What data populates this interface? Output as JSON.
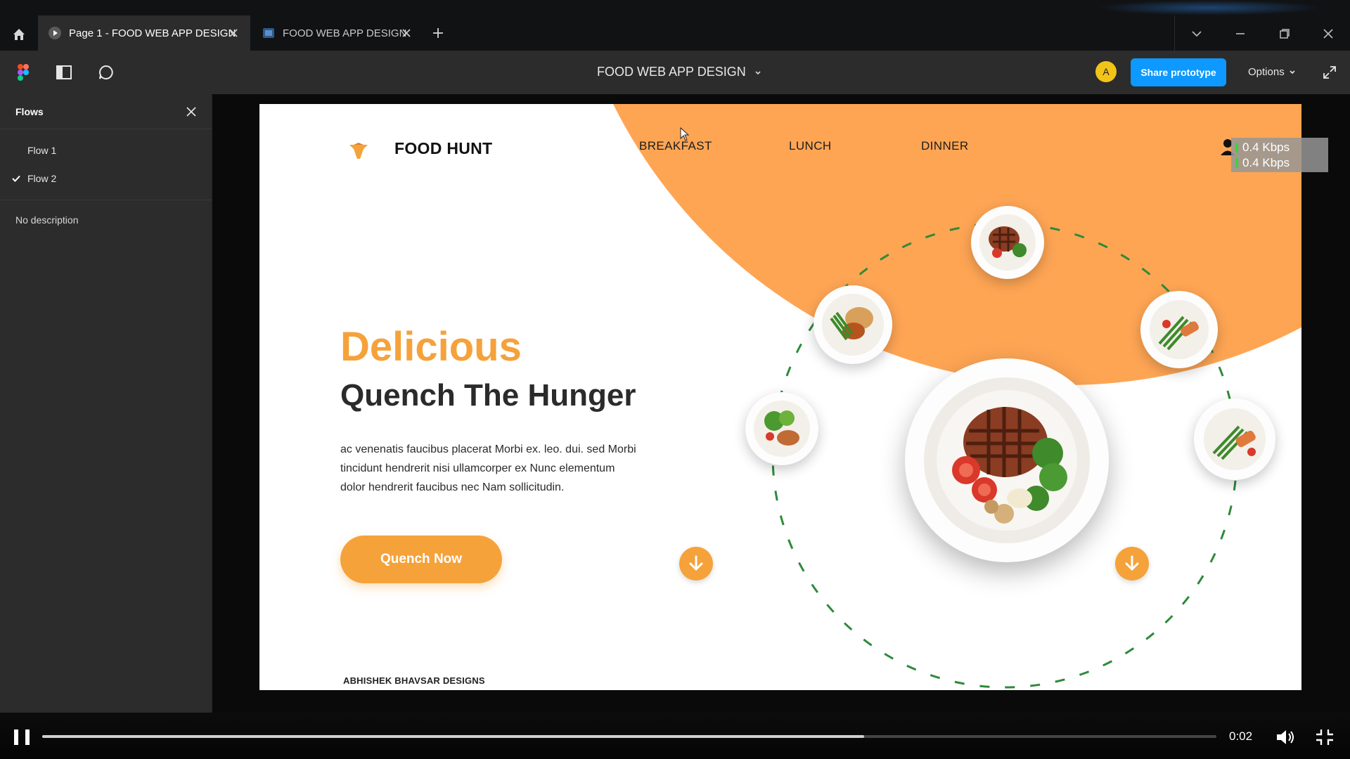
{
  "tabs": [
    {
      "label": "Page 1 - FOOD WEB APP DESIGN",
      "active": true
    },
    {
      "label": "FOOD WEB APP DESIGN",
      "active": false
    }
  ],
  "toolbar": {
    "doc_title": "FOOD WEB APP DESIGN",
    "avatar_initial": "A",
    "share_label": "Share prototype",
    "options_label": "Options"
  },
  "sidebar": {
    "title": "Flows",
    "flows": [
      {
        "label": "Flow 1",
        "selected": false
      },
      {
        "label": "Flow 2",
        "selected": true
      }
    ],
    "description": "No description"
  },
  "prototype": {
    "brand": "FOOD HUNT",
    "nav": [
      "BREAKFAST",
      "LUNCH",
      "DINNER"
    ],
    "eyebrow": "Delicious",
    "headline": "Quench The Hunger",
    "body": "ac venenatis faucibus placerat Morbi ex. leo. dui. sed Morbi tincidunt hendrerit nisi ullamcorper ex Nunc elementum dolor hendrerit faucibus nec Nam sollicitudin.",
    "cta_label": "Quench Now",
    "credit": "ABHISHEK BHAVSAR DESIGNS",
    "accent_color": "#f5a23b",
    "arc_color": "#fea554"
  },
  "network_overlay": {
    "upload": "0.4 Kbps",
    "download": "0.4 Kbps"
  },
  "player": {
    "time": "0:02",
    "progress_fraction": 0.7
  }
}
